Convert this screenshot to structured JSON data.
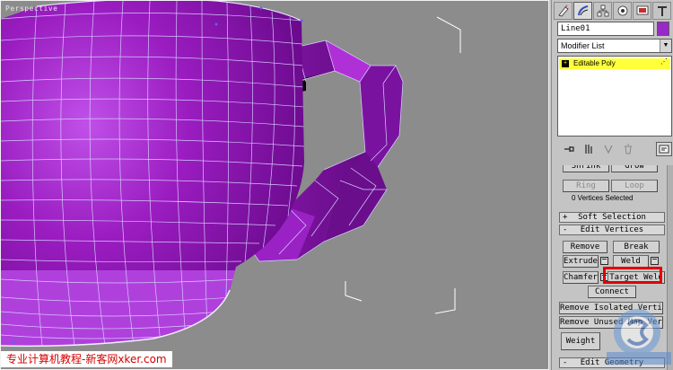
{
  "viewport": {
    "label": "Perspective",
    "watermark": "专业计算机教程-新客网xker.com"
  },
  "panel": {
    "tabs": [
      {
        "icon": "create-icon"
      },
      {
        "icon": "modify-icon"
      },
      {
        "icon": "hierarchy-icon"
      },
      {
        "icon": "motion-icon"
      },
      {
        "icon": "display-icon"
      },
      {
        "icon": "utilities-icon"
      }
    ],
    "object_name": "Line01",
    "object_color": "#9a28c8",
    "modifier_list": "Modifier List",
    "stack": {
      "item": "Editable Poly",
      "highlight_color": "#ffff3a"
    },
    "selection": {
      "shrink": "Shrink",
      "grow": "Grow",
      "ring": "Ring",
      "loop": "Loop",
      "info": "0 Vertices Selected"
    },
    "soft_selection": {
      "sign": "+",
      "title": "Soft Selection"
    },
    "edit_vertices": {
      "sign": "-",
      "title": "Edit Vertices",
      "remove": "Remove",
      "break": "Break",
      "extrude": "Extrude",
      "weld": "Weld",
      "chamfer": "Chamfer",
      "target_weld": "Target Weld",
      "connect": "Connect",
      "remove_isolated": "Remove Isolated Vertices",
      "remove_unused": "Remove Unused Map Verts",
      "weight": "Weight"
    },
    "edit_geometry": {
      "sign": "-",
      "title": "Edit Geometry"
    }
  },
  "colors": {
    "mesh_purple": "#9a1cc0",
    "wire": "#d8d0ff",
    "highlight": "#e00000"
  }
}
